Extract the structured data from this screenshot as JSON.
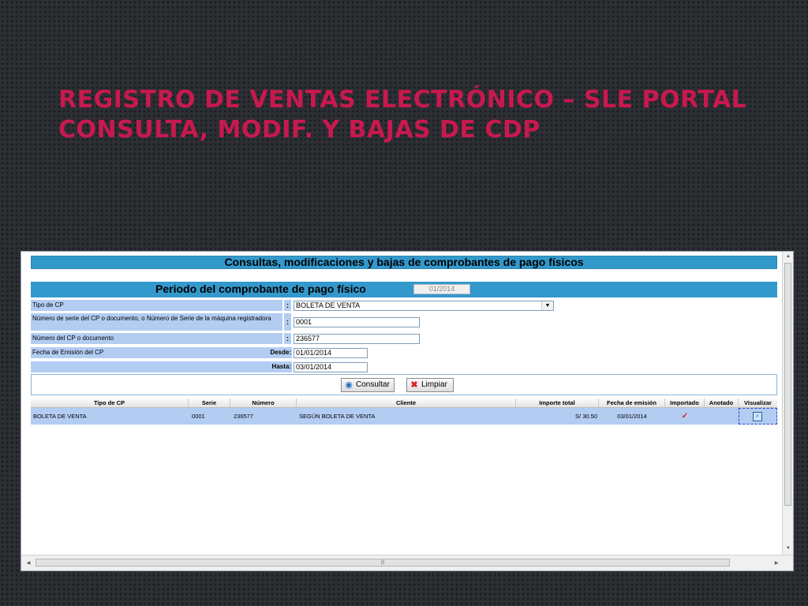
{
  "slide": {
    "title_line1": "REGISTRO DE VENTAS ELECTRÓNICO – SLE PORTAL",
    "title_line2": "CONSULTA, MODIF. Y BAJAS DE CDP",
    "title_color": "#c8194e"
  },
  "form": {
    "header_title": "Consultas, modificaciones y bajas de comprobantes de pago físicos",
    "period_label": "Periodo del comprobante de pago físico",
    "period_value": "01/2014",
    "tipo_cp_label": "Tipo de CP",
    "tipo_cp_value": "BOLETA DE VENTA",
    "serie_label": "Número de serie del CP o documento, o Número de Serie de la máquina registradora",
    "serie_value": "0001",
    "numero_label": "Número del CP o documento",
    "numero_value": "236577",
    "fecha_label": "Fecha de Emisión del CP",
    "desde_label": "Desde:",
    "desde_value": "01/01/2014",
    "hasta_label": "Hasta:",
    "hasta_value": "03/01/2014",
    "colon": ":",
    "consultar_label": "Consultar",
    "limpiar_label": "Limpiar",
    "accent_color": "#3399cc",
    "label_bg_color": "#b3cdf2"
  },
  "table": {
    "headers": [
      "Tipo de CP",
      "Serie",
      "Número",
      "Cliente",
      "Importe total",
      "Fecha de emisión",
      "Importado",
      "Anotado",
      "Visualizar"
    ],
    "rows": [
      {
        "tipo": "BOLETA DE VENTA",
        "serie": "0001",
        "numero": "236577",
        "cliente": "SEGÚN BOLETA DE VENTA",
        "importe": "S/ 30.50",
        "fecha": "03/01/2014",
        "importado_icon": "checkmark-icon",
        "anotado": "",
        "visualizar_icon": "magnifier-icon"
      }
    ]
  },
  "icons": {
    "consultar": "play-circle-icon",
    "limpiar": "red-x-icon",
    "dropdown": "chevron-down-icon"
  }
}
